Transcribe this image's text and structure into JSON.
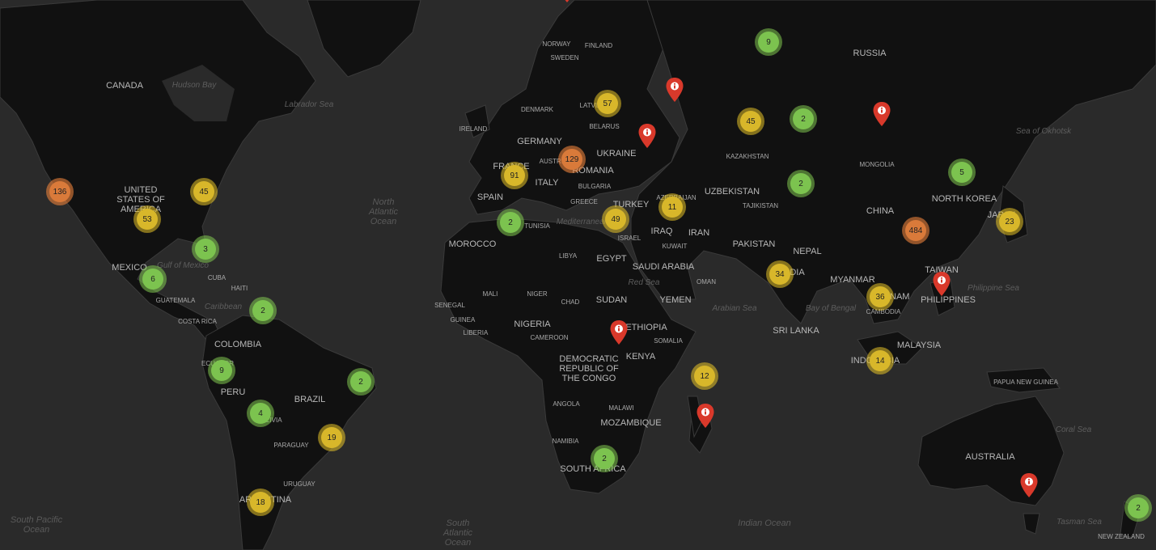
{
  "map": {
    "countries": [
      {
        "id": "canada",
        "text": "CANADA"
      },
      {
        "id": "usa",
        "text": "UNITED\nSTATES OF\nAMERICA"
      },
      {
        "id": "mexico",
        "text": "MEXICO"
      },
      {
        "id": "cuba",
        "text": "CUBA",
        "small": true
      },
      {
        "id": "haiti",
        "text": "HAITI",
        "small": true
      },
      {
        "id": "guatemala",
        "text": "GUATEMALA",
        "small": true
      },
      {
        "id": "costa-rica",
        "text": "COSTA RICA",
        "small": true
      },
      {
        "id": "colombia",
        "text": "COLOMBIA"
      },
      {
        "id": "ecuador",
        "text": "ECUADOR",
        "small": true
      },
      {
        "id": "peru",
        "text": "PERU"
      },
      {
        "id": "brazil",
        "text": "BRAZIL"
      },
      {
        "id": "bolivia",
        "text": "BOLIVIA",
        "small": true
      },
      {
        "id": "paraguay",
        "text": "PARAGUAY",
        "small": true
      },
      {
        "id": "uruguay",
        "text": "URUGUAY",
        "small": true
      },
      {
        "id": "argentina",
        "text": "ARGENTINA"
      },
      {
        "id": "norway",
        "text": "NORWAY",
        "small": true
      },
      {
        "id": "sweden",
        "text": "SWEDEN",
        "small": true
      },
      {
        "id": "finland",
        "text": "FINLAND",
        "small": true
      },
      {
        "id": "denmark",
        "text": "DENMARK",
        "small": true
      },
      {
        "id": "ireland",
        "text": "IRELAND",
        "small": true
      },
      {
        "id": "latvia",
        "text": "LATVIA",
        "small": true
      },
      {
        "id": "belarus",
        "text": "BELARUS",
        "small": true
      },
      {
        "id": "germany",
        "text": "GERMANY"
      },
      {
        "id": "france",
        "text": "FRANCE"
      },
      {
        "id": "austria",
        "text": "AUSTRIA",
        "small": true
      },
      {
        "id": "ukraine",
        "text": "UKRAINE"
      },
      {
        "id": "romania",
        "text": "ROMANIA"
      },
      {
        "id": "bulgaria",
        "text": "BULGARIA",
        "small": true
      },
      {
        "id": "spain",
        "text": "SPAIN"
      },
      {
        "id": "italy",
        "text": "ITALY"
      },
      {
        "id": "greece",
        "text": "GREECE",
        "small": true
      },
      {
        "id": "turkey",
        "text": "TURKEY"
      },
      {
        "id": "azerbaijan",
        "text": "AZERBAIJAN",
        "small": true
      },
      {
        "id": "tunisia",
        "text": "TUNISIA",
        "small": true
      },
      {
        "id": "morocco",
        "text": "MOROCCO"
      },
      {
        "id": "libya",
        "text": "LIBYA",
        "small": true
      },
      {
        "id": "egypt",
        "text": "EGYPT"
      },
      {
        "id": "israel",
        "text": "ISRAEL",
        "small": true
      },
      {
        "id": "iraq",
        "text": "IRAQ"
      },
      {
        "id": "kuwait",
        "text": "KUWAIT",
        "small": true
      },
      {
        "id": "iran",
        "text": "IRAN"
      },
      {
        "id": "saudi-arabia",
        "text": "SAUDI ARABIA"
      },
      {
        "id": "oman",
        "text": "OMAN",
        "small": true
      },
      {
        "id": "yemen",
        "text": "YEMEN"
      },
      {
        "id": "mali",
        "text": "MALI",
        "small": true
      },
      {
        "id": "niger",
        "text": "NIGER",
        "small": true
      },
      {
        "id": "chad",
        "text": "CHAD",
        "small": true
      },
      {
        "id": "sudan",
        "text": "SUDAN"
      },
      {
        "id": "senegal",
        "text": "SENEGAL",
        "small": true
      },
      {
        "id": "guinea",
        "text": "GUINEA",
        "small": true
      },
      {
        "id": "liberia",
        "text": "LIBERIA",
        "small": true
      },
      {
        "id": "nigeria",
        "text": "NIGERIA"
      },
      {
        "id": "cameroon",
        "text": "CAMEROON",
        "small": true
      },
      {
        "id": "ethiopia",
        "text": "ETHIOPIA"
      },
      {
        "id": "somalia",
        "text": "SOMALIA",
        "small": true
      },
      {
        "id": "kenya",
        "text": "KENYA"
      },
      {
        "id": "drc",
        "text": "DEMOCRATIC\nREPUBLIC OF\nTHE CONGO"
      },
      {
        "id": "angola",
        "text": "ANGOLA",
        "small": true
      },
      {
        "id": "malawi",
        "text": "MALAWI",
        "small": true
      },
      {
        "id": "mozambique",
        "text": "MOZAMBIQUE"
      },
      {
        "id": "namibia",
        "text": "NAMIBIA",
        "small": true
      },
      {
        "id": "south-africa",
        "text": "SOUTH AFRICA"
      },
      {
        "id": "russia",
        "text": "RUSSIA"
      },
      {
        "id": "kazakhstan",
        "text": "KAZAKHSTAN",
        "small": true
      },
      {
        "id": "uzbekistan",
        "text": "UZBEKISTAN"
      },
      {
        "id": "tajikistan",
        "text": "TAJIKISTAN",
        "small": true
      },
      {
        "id": "mongolia",
        "text": "MONGOLIA",
        "small": true
      },
      {
        "id": "china",
        "text": "CHINA"
      },
      {
        "id": "north-korea",
        "text": "NORTH KOREA"
      },
      {
        "id": "japan",
        "text": "JAPAN"
      },
      {
        "id": "pakistan",
        "text": "PAKISTAN"
      },
      {
        "id": "nepal",
        "text": "NEPAL"
      },
      {
        "id": "india",
        "text": "INDIA"
      },
      {
        "id": "myanmar",
        "text": "MYANMAR"
      },
      {
        "id": "vietnam",
        "text": "VIETNAM"
      },
      {
        "id": "cambodia",
        "text": "CAMBODIA",
        "small": true
      },
      {
        "id": "taiwan",
        "text": "TAIWAN"
      },
      {
        "id": "philippines",
        "text": "PHILIPPINES"
      },
      {
        "id": "sri-lanka",
        "text": "SRI LANKA"
      },
      {
        "id": "malaysia",
        "text": "MALAYSIA"
      },
      {
        "id": "indonesia",
        "text": "INDONESIA"
      },
      {
        "id": "papua-new-guinea",
        "text": "PAPUA NEW GUINEA",
        "small": true
      },
      {
        "id": "australia",
        "text": "AUSTRALIA"
      },
      {
        "id": "new-zealand",
        "text": "NEW ZEALAND",
        "small": true
      }
    ],
    "water": [
      {
        "id": "hudson-bay",
        "text": "Hudson Bay",
        "kind": "sea"
      },
      {
        "id": "labrador-sea",
        "text": "Labrador Sea",
        "kind": "sea"
      },
      {
        "id": "north-atlantic",
        "text": "North\nAtlantic\nOcean",
        "kind": "ocean"
      },
      {
        "id": "gulf-of-mexico",
        "text": "Gulf of Mexico",
        "kind": "sea"
      },
      {
        "id": "caribbean",
        "text": "Caribbean",
        "kind": "sea"
      },
      {
        "id": "mediterranean",
        "text": "Mediterranean",
        "kind": "sea"
      },
      {
        "id": "red-sea",
        "text": "Red Sea",
        "kind": "sea"
      },
      {
        "id": "arabian-sea",
        "text": "Arabian Sea",
        "kind": "sea"
      },
      {
        "id": "bay-of-bengal",
        "text": "Bay of Bengal",
        "kind": "sea"
      },
      {
        "id": "philippine-sea",
        "text": "Philippine Sea",
        "kind": "sea"
      },
      {
        "id": "sea-of-okhotsk",
        "text": "Sea of Okhotsk",
        "kind": "sea"
      },
      {
        "id": "coral-sea",
        "text": "Coral Sea",
        "kind": "sea"
      },
      {
        "id": "tasman-sea",
        "text": "Tasman Sea",
        "kind": "sea"
      },
      {
        "id": "indian-ocean",
        "text": "Indian Ocean",
        "kind": "ocean"
      },
      {
        "id": "south-atlantic",
        "text": "South\nAtlantic\nOcean",
        "kind": "ocean"
      },
      {
        "id": "south-pacific",
        "text": "South Pacific\nOcean",
        "kind": "ocean"
      }
    ],
    "clusters": [
      {
        "id": "california",
        "count": "136",
        "size": "large"
      },
      {
        "id": "texas",
        "count": "53",
        "size": "medium"
      },
      {
        "id": "us-east",
        "count": "45",
        "size": "medium"
      },
      {
        "id": "florida",
        "count": "3",
        "size": "small"
      },
      {
        "id": "mexico-city",
        "count": "6",
        "size": "small"
      },
      {
        "id": "venezuela",
        "count": "2",
        "size": "small"
      },
      {
        "id": "ecuador",
        "count": "9",
        "size": "small"
      },
      {
        "id": "bolivia",
        "count": "4",
        "size": "small"
      },
      {
        "id": "brazil-ne",
        "count": "2",
        "size": "small"
      },
      {
        "id": "brazil-se",
        "count": "19",
        "size": "medium"
      },
      {
        "id": "argentina",
        "count": "18",
        "size": "medium"
      },
      {
        "id": "russia-north",
        "count": "9",
        "size": "small"
      },
      {
        "id": "baltic",
        "count": "57",
        "size": "medium"
      },
      {
        "id": "central-europe",
        "count": "129",
        "size": "large"
      },
      {
        "id": "western-europe",
        "count": "91",
        "size": "medium"
      },
      {
        "id": "algeria",
        "count": "2",
        "size": "small"
      },
      {
        "id": "israel",
        "count": "49",
        "size": "medium"
      },
      {
        "id": "caucasus",
        "count": "11",
        "size": "medium"
      },
      {
        "id": "urals",
        "count": "45",
        "size": "medium"
      },
      {
        "id": "siberia",
        "count": "2",
        "size": "small"
      },
      {
        "id": "central-asia",
        "count": "2",
        "size": "small"
      },
      {
        "id": "india",
        "count": "34",
        "size": "medium"
      },
      {
        "id": "china-east",
        "count": "484",
        "size": "large"
      },
      {
        "id": "korea",
        "count": "5",
        "size": "small"
      },
      {
        "id": "japan",
        "count": "23",
        "size": "medium"
      },
      {
        "id": "southeast-asia",
        "count": "36",
        "size": "medium"
      },
      {
        "id": "indonesia",
        "count": "14",
        "size": "medium"
      },
      {
        "id": "seychelles",
        "count": "12",
        "size": "medium"
      },
      {
        "id": "south-africa",
        "count": "2",
        "size": "small"
      },
      {
        "id": "new-zealand",
        "count": "2",
        "size": "small"
      }
    ],
    "markers": [
      {
        "id": "norway"
      },
      {
        "id": "moscow"
      },
      {
        "id": "ukraine"
      },
      {
        "id": "siberia"
      },
      {
        "id": "kenya"
      },
      {
        "id": "madagascar"
      },
      {
        "id": "philippines"
      },
      {
        "id": "melbourne"
      }
    ],
    "colors": {
      "water": "#2a2a2a",
      "land": "#111111",
      "border": "#3a3a3a",
      "cluster_small": "#7cc34f",
      "cluster_medium": "#d8b72a",
      "cluster_large": "#d97a3a",
      "marker": "#d9392b"
    },
    "icons": {
      "marker": "map-pin-info-icon"
    }
  }
}
